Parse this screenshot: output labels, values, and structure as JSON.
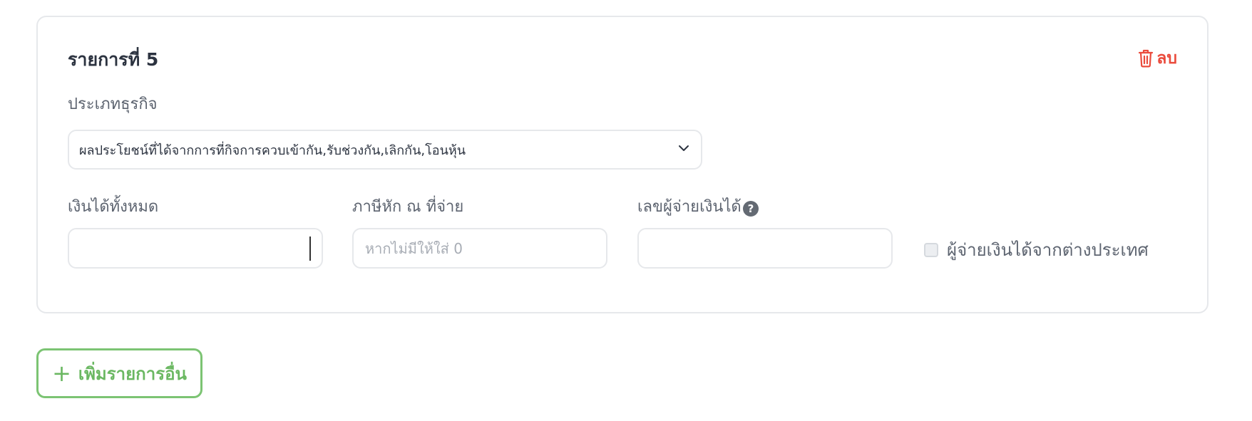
{
  "item_card": {
    "title": "รายการที่ 5",
    "delete_label": "ลบ",
    "business_type": {
      "label": "ประเภทธุรกิจ",
      "selected_value": "ผลประโยชน์ที่ได้จากการที่กิจการควบเข้ากัน,รับช่วงกัน,เลิกกัน,โอนหุ้น"
    },
    "total_income": {
      "label": "เงินได้ทั้งหมด",
      "value": "",
      "placeholder": ""
    },
    "withholding_tax": {
      "label": "ภาษีหัก ณ ที่จ่าย",
      "value": "",
      "placeholder": "หากไม่มีให้ใส่ 0"
    },
    "payer_id": {
      "label": "เลขผู้จ่ายเงินได้",
      "value": "",
      "placeholder": "",
      "help_glyph": "?"
    },
    "foreign_payer": {
      "label": "ผู้จ่ายเงินได้จากต่างประเทศ",
      "checked": false
    }
  },
  "add_item": {
    "plus_glyph": "+",
    "label": "เพิ่มรายการอื่น"
  },
  "colors": {
    "delete": "#ea4b3c",
    "add_button": "#7cc473",
    "border": "#e6e8eb",
    "text": "#2c3340",
    "label": "#5d6470"
  },
  "icons": {
    "delete": "trash-icon",
    "dropdown": "chevron-down-icon",
    "help": "question-circle-icon",
    "add": "plus-icon"
  }
}
